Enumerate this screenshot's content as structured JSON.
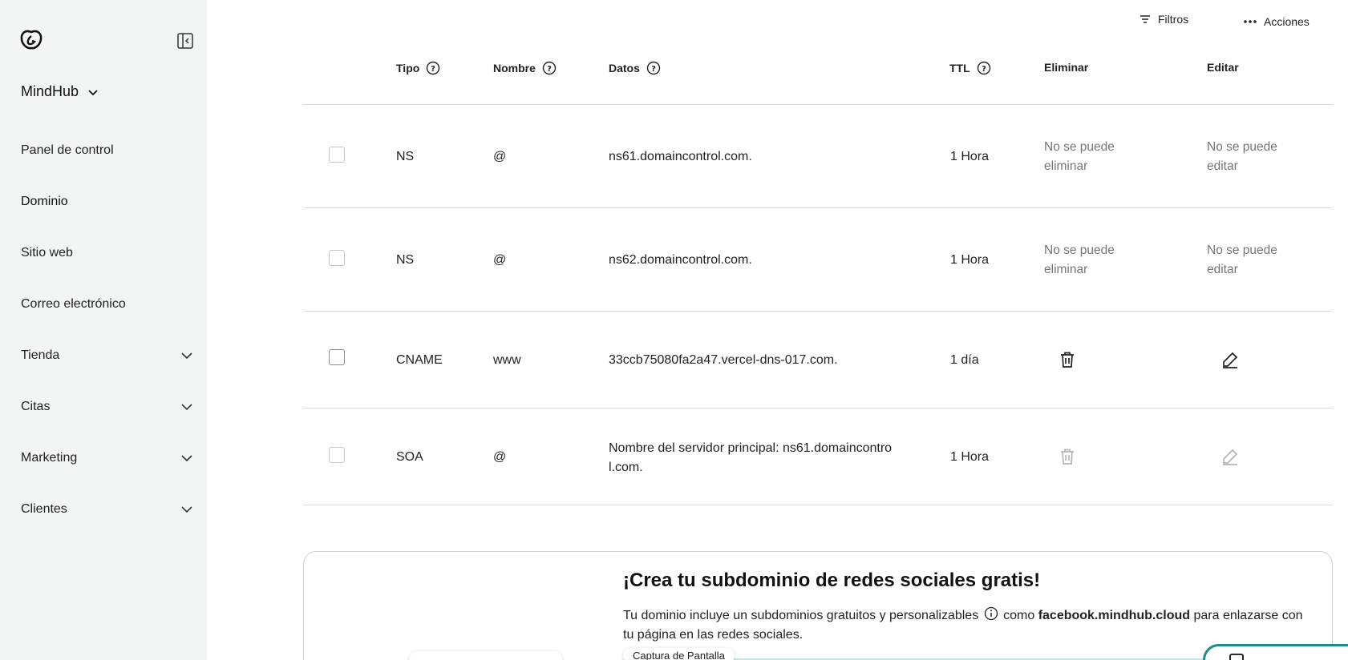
{
  "sidebar": {
    "brand": "MindHub",
    "items": [
      {
        "label": "Panel de control"
      },
      {
        "label": "Dominio"
      },
      {
        "label": "Sitio web"
      },
      {
        "label": "Correo electrónico"
      },
      {
        "label": "Tienda"
      },
      {
        "label": "Citas"
      },
      {
        "label": "Marketing"
      },
      {
        "label": "Clientes"
      }
    ]
  },
  "toolbar": {
    "filters_label": "Filtros",
    "actions_label": "Acciones"
  },
  "table": {
    "headers": {
      "type": "Tipo",
      "name": "Nombre",
      "data": "Datos",
      "ttl": "TTL",
      "delete": "Eliminar",
      "edit": "Editar"
    },
    "rows": [
      {
        "type": "NS",
        "name": "@",
        "data": "ns61.domaincontrol.com.",
        "ttl": "1 Hora",
        "delete_line1": "No se puede",
        "delete_line2": "eliminar",
        "edit_line1": "No se puede",
        "edit_line2": "editar"
      },
      {
        "type": "NS",
        "name": "@",
        "data": "ns62.domaincontrol.com.",
        "ttl": "1 Hora",
        "delete_line1": "No se puede",
        "delete_line2": "eliminar",
        "edit_line1": "No se puede",
        "edit_line2": "editar"
      },
      {
        "type": "CNAME",
        "name": "www",
        "data": "33ccb75080fa2a47.vercel-dns-017.com.",
        "ttl": "1 día"
      },
      {
        "type": "SOA",
        "name": "@",
        "data_line1": "Nombre del servidor principal: ns61.domaincontro",
        "data_line2": "l.com.",
        "ttl": "1 Hora"
      }
    ]
  },
  "promo": {
    "title": "¡Crea tu subdominio de redes sociales gratis!",
    "text_before": "Tu dominio incluye un subdominios gratuitos y personalizables",
    "text_mid": "como",
    "text_bold": "facebook.mindhub.cloud",
    "text_after": "para enlazarse con tu página en las redes sociales.",
    "screenshot_tag": "Captura de Pantalla"
  },
  "colors": {
    "sidebar_bg": "#f3f5f5",
    "divider": "#d9dcdd",
    "accent": "#1f8a8a",
    "muted_text": "#767676"
  }
}
